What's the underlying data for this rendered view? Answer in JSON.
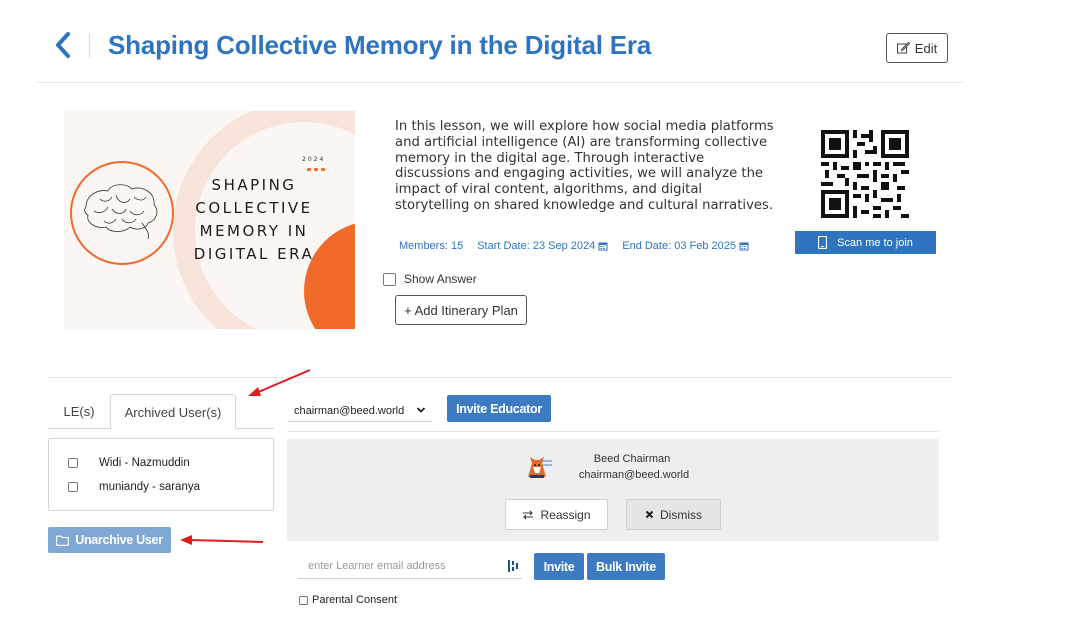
{
  "header": {
    "title": "Shaping Collective Memory in the Digital Era",
    "edit_label": "Edit"
  },
  "cover": {
    "year": "2024",
    "lines": [
      "SHAPING",
      "COLLECTIVE",
      "MEMORY IN",
      "DIGITAL ERA"
    ]
  },
  "lesson": {
    "description": "In this lesson, we will explore how social media platforms and artificial intelligence (AI) are transforming collective memory in the digital age. Through interactive discussions and engaging activities, we will analyze the impact of viral content, algorithms, and digital storytelling on shared knowledge and cultural narratives.",
    "members": "Members: 15",
    "start_date": "Start Date: 23 Sep 2024",
    "end_date": "End Date: 03 Feb 2025",
    "show_answer_label": "Show Answer",
    "add_itinerary_label": "+ Add Itinerary Plan",
    "scan_label": "Scan me to join"
  },
  "tabs": {
    "le_label": "LE(s)",
    "archived_label": "Archived User(s)"
  },
  "archived_users": [
    {
      "name": "Widi - Nazmuddin"
    },
    {
      "name": "muniandy - saranya"
    }
  ],
  "unarchive_label": "Unarchive User",
  "educator": {
    "selected_email": "chairman@beed.world",
    "invite_label": "Invite Educator",
    "name": "Beed Chairman",
    "email": "chairman@beed.world",
    "reassign_label": "Reassign",
    "dismiss_label": "Dismiss"
  },
  "learner": {
    "placeholder": "enter Learner email address",
    "invite_label": "Invite",
    "bulk_invite_label": "Bulk Invite",
    "parental_consent_label": "Parental Consent"
  },
  "colors": {
    "brand_blue": "#2f74c0",
    "button_blue": "#3c7bc2",
    "disabled_blue": "#7fa8d4",
    "cover_orange": "#f26a2b",
    "annotation_red": "#e11d1d"
  }
}
